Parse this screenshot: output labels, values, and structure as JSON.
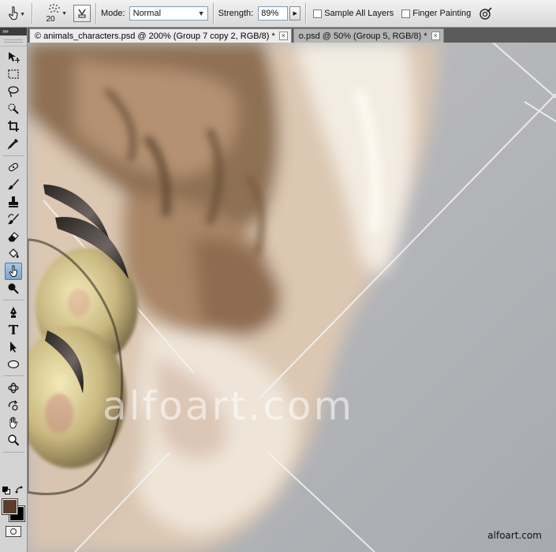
{
  "options_bar": {
    "active_tool_icon": "smudge-icon",
    "brush_size": "20",
    "mode_label": "Mode:",
    "mode_value": "Normal",
    "strength_label": "Strength:",
    "strength_value": "89%",
    "sample_all_layers_label": "Sample All Layers",
    "sample_all_layers_checked": false,
    "finger_painting_label": "Finger Painting",
    "finger_painting_checked": false
  },
  "tools_panel": {
    "collapse_glyph": "»»",
    "active_tool": "smudge-tool",
    "foreground_color": "#5a3c29",
    "background_color": "#000000"
  },
  "tabs": [
    {
      "label": "© animals_characters.psd @ 200% (Group 7 copy 2, RGB/8) *",
      "active": true,
      "close": "×"
    },
    {
      "label": "o.psd @ 50% (Group 5, RGB/8) *",
      "active": false,
      "close": "×"
    }
  ],
  "canvas": {
    "watermark": "alfoart.com",
    "credit": "alfoart.com"
  }
}
